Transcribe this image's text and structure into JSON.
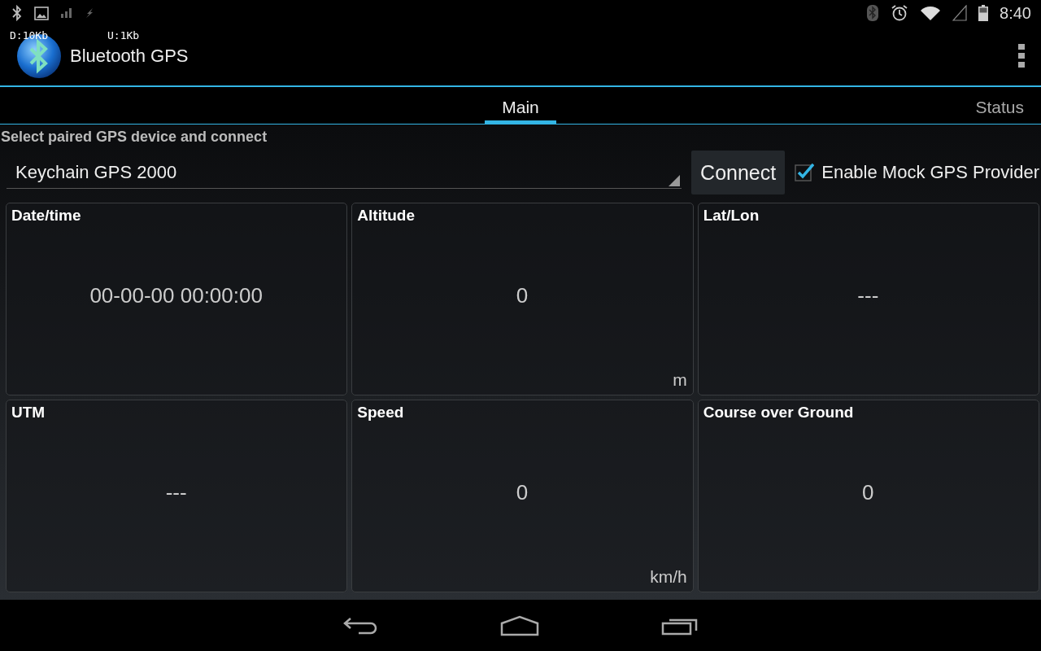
{
  "status_bar": {
    "time": "8:40"
  },
  "traffic": {
    "download": "D:10Kb",
    "upload": "U:1Kb"
  },
  "app_bar": {
    "title": "Bluetooth GPS"
  },
  "tabs": [
    {
      "label": "Main",
      "selected": true
    },
    {
      "label": "Status",
      "selected": false
    }
  ],
  "connect_section": {
    "heading": "Select paired GPS device and connect",
    "device": "Keychain GPS 2000",
    "button": "Connect",
    "mock_provider": {
      "label": "Enable Mock GPS Provider",
      "checked": true
    }
  },
  "panels": [
    {
      "title": "Date/time",
      "value": "00-00-00 00:00:00"
    },
    {
      "title": "Altitude",
      "value": "0",
      "unit": "m"
    },
    {
      "title": "Lat/Lon",
      "value": "---"
    },
    {
      "title": "UTM",
      "value": "---"
    },
    {
      "title": "Speed",
      "value": "0",
      "unit": "km/h"
    },
    {
      "title": "Course over Ground",
      "value": "0"
    }
  ]
}
